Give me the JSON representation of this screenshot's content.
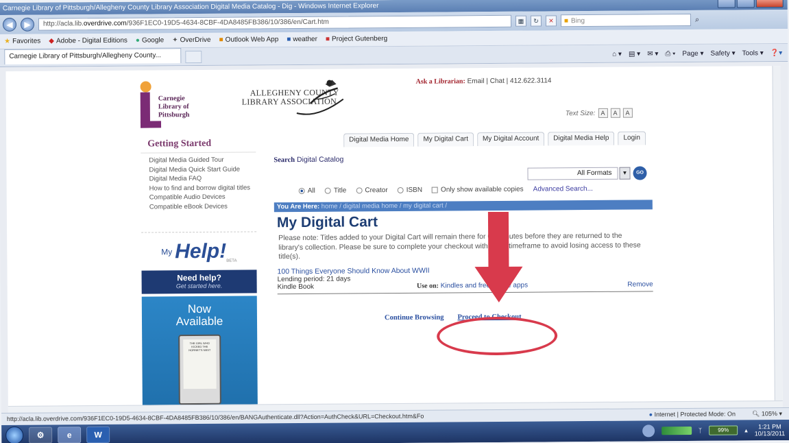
{
  "browser": {
    "window_title": "Carnegie Library of Pittsburgh/Allegheny County Library Association Digital Media Catalog - Dig - Windows Internet Explorer",
    "address_prefix": "http://acla.lib.",
    "address_domain": "overdrive.com",
    "address_rest": "/936F1EC0-19D5-4634-8CBF-4DA8485FB386/10/386/en/Cart.htm",
    "search_placeholder": "Bing",
    "favorites_label": "Favorites",
    "favorites": [
      "Adobe - Digital Editions",
      "Google",
      "OverDrive",
      "Outlook Web App",
      "weather",
      "Project Gutenberg"
    ],
    "tab_title": "Carnegie Library of Pittsburgh/Allegheny County...",
    "commands": [
      "Page ▾",
      "Safety ▾",
      "Tools ▾"
    ]
  },
  "header": {
    "logo_text": [
      "Carnegie",
      "Library of",
      "Pittsburgh"
    ],
    "acla_line1": "ALLEGHENY COUNTY",
    "acla_line2": "LIBRARY ASSOCIATION",
    "ask_label": "Ask a Librarian:",
    "ask_links": "Email | Chat | 412.622.3114",
    "text_size_label": "Text Size:",
    "text_size_options": [
      "A",
      "A",
      "A"
    ]
  },
  "nav": {
    "tabs": [
      "Digital Media Home",
      "My Digital Cart",
      "My Digital Account",
      "Digital Media Help",
      "Login"
    ]
  },
  "sidebar": {
    "heading": "Getting Started",
    "links": [
      "Digital Media Guided Tour",
      "Digital Media Quick Start Guide",
      "Digital Media FAQ",
      "How to find and borrow digital titles",
      "Compatible Audio Devices",
      "Compatible eBook Devices"
    ],
    "myhelp_my": "My",
    "myhelp_help": "Help!",
    "myhelp_beta": "BETA",
    "need_help_title": "Need help?",
    "need_help_sub": "Get started here.",
    "now_available": "Now Available",
    "kindle_screen_text": "THE GIRL WHO KICKED THE HORNET'S NEST"
  },
  "search": {
    "label_bold": "Search",
    "label_rest": "Digital Catalog",
    "format_value": "All Formats",
    "go_label": "GO",
    "radio_options": [
      "All",
      "Title",
      "Creator",
      "ISBN"
    ],
    "available_only": "Only show available copies",
    "advanced": "Advanced Search..."
  },
  "breadcrumb": {
    "label": "You Are Here:",
    "path": "home / digital media home / my digital cart /"
  },
  "main": {
    "title": "My Digital Cart",
    "note": "Please note: Titles added to your Digital Cart will remain there for 60 minutes before they are returned to the library's collection. Please be sure to complete your checkout within this timeframe to avoid losing access to these title(s).",
    "item": {
      "title": "100 Things Everyone Should Know About WWII",
      "lending": "Lending period: 21 days",
      "format": "Kindle Book",
      "use_on_label": "Use on:",
      "use_on_value": "Kindles and free Kindle apps",
      "remove": "Remove"
    },
    "continue_browsing": "Continue Browsing",
    "proceed_checkout": "Proceed to Checkout"
  },
  "status": {
    "url": "http://acla.lib.overdrive.com/936F1EC0-19D5-4634-8CBF-4DA8485FB386/10/386/en/BANGAuthenticate.dll?Action=AuthCheck&URL=Checkout.htm&Fo",
    "zone": "Internet | Protected Mode: On",
    "zoom": "105%"
  },
  "taskbar": {
    "word_icon": "W",
    "battery": "99%",
    "time": "1:21 PM",
    "date": "10/13/2011"
  },
  "colors": {
    "accent_blue": "#2a4fa0",
    "annotation_red": "#d83a4c",
    "library_purple": "#7b2b75"
  }
}
